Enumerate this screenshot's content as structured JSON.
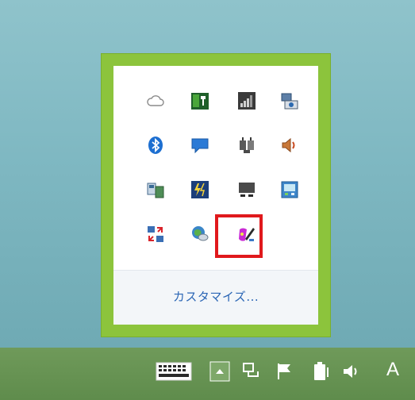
{
  "tray": {
    "customize_label": "カスタマイズ..."
  },
  "taskbar": {
    "ime_label": "A"
  },
  "icons": [
    "onedrive-cloud-icon",
    "usb-safely-remove-icon",
    "signal-strength-icon",
    "network-settings-icon",
    "bluetooth-icon",
    "chat-message-icon",
    "usb-plug-icon",
    "volume-icon",
    "device-manager-icon",
    "power-boost-icon",
    "monitor-display-icon",
    "calculator-screen-icon",
    "sync-swap-icon",
    "web-globe-icon",
    "paint-app-icon",
    "keyboard-icon",
    "show-hidden-icons-chevron",
    "network-icon",
    "action-center-flag-icon",
    "battery-icon",
    "speaker-icon"
  ],
  "colors": {
    "flyout_border": "#8cc43c",
    "highlight": "#e0191c",
    "link": "#2b66b5",
    "taskbar": "#6a9455"
  }
}
